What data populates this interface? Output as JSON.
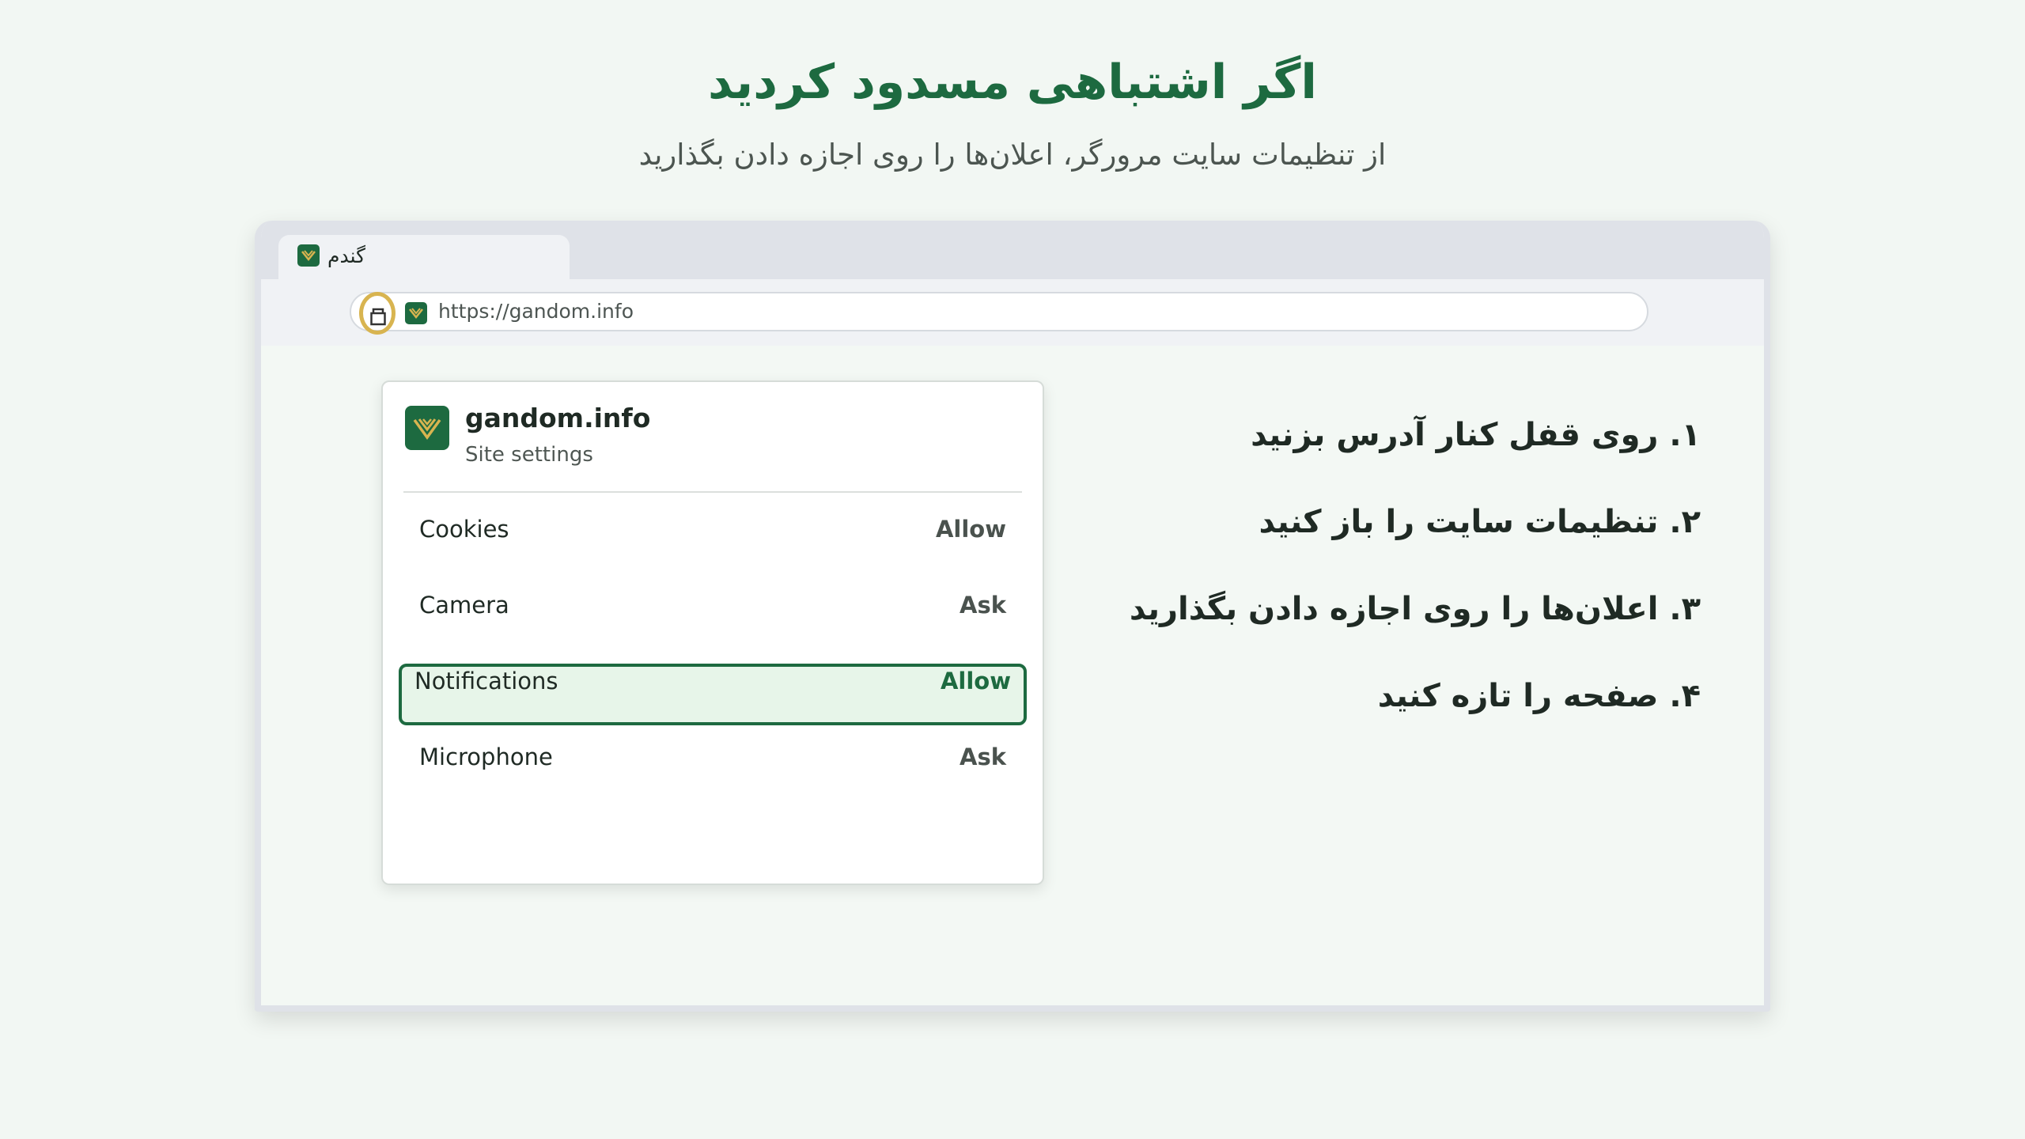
{
  "header": {
    "title": "اگر اشتباهی مسدود کردید",
    "subtitle": "از تنظیمات سایت مرورگر، اعلان‌ها را روی اجازه دادن بگذارید"
  },
  "browser": {
    "tab_title": "گندم",
    "url": "https://gandom.info"
  },
  "popup": {
    "domain": "gandom.info",
    "subtitle": "Site settings",
    "permissions": [
      {
        "name": "Cookies",
        "value": "Allow"
      },
      {
        "name": "Camera",
        "value": "Ask"
      },
      {
        "name": "Notifications",
        "value": "Allow"
      },
      {
        "name": "Microphone",
        "value": "Ask"
      }
    ]
  },
  "steps": [
    "۱. روی قفل کنار آدرس بزنید",
    "۲. تنظیمات سایت را باز کنید",
    "۳. اعلان‌ها را روی اجازه دادن بگذارید",
    "۴. صفحه را تازه کنید"
  ],
  "colors": {
    "brand": "#1d6a40",
    "accent": "#d8b450",
    "highlight_bg": "#e7f5e9"
  },
  "icons": {
    "site": "wheat-logo-icon",
    "lock": "lock-icon"
  }
}
